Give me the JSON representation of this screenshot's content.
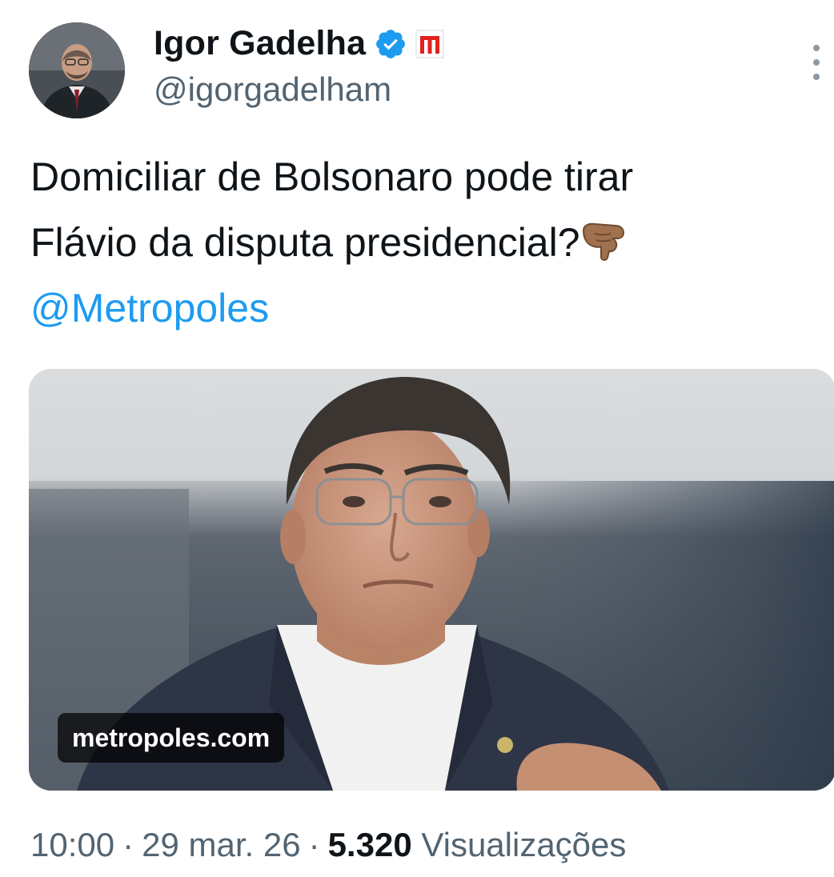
{
  "author": {
    "name": "Igor Gadelha",
    "handle": "@igorgadelham",
    "verified_color": "#1d9bf0",
    "affiliation_badge": "metropoles-logo",
    "affiliation_color": "#e0211d"
  },
  "tweet": {
    "line1": "Domiciliar de Bolsonaro pode tirar",
    "line2": "Flávio da disputa presidencial?",
    "emoji": "backhand-index-pointing-down",
    "mention": "@Metropoles"
  },
  "card": {
    "domain": "metropoles.com",
    "image": "photo-of-man-in-suit-with-glasses"
  },
  "meta": {
    "time": "10:00",
    "date": "29 mar. 26",
    "views_count": "5.320",
    "views_label": "Visualizações"
  }
}
